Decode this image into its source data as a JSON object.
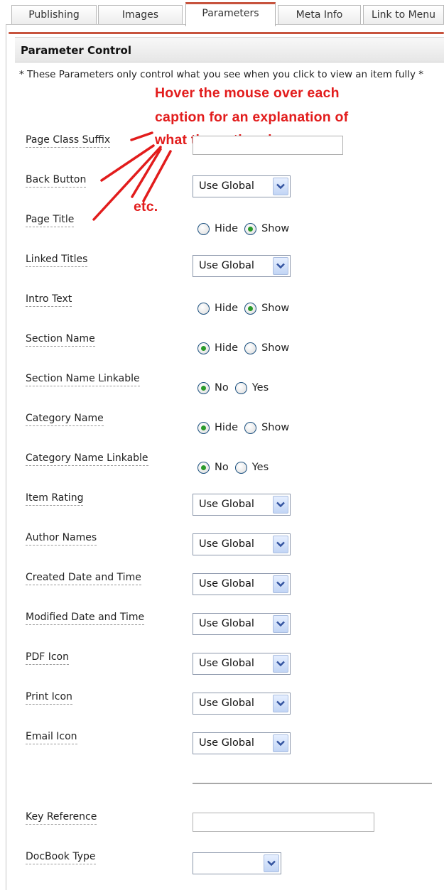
{
  "tabs": [
    {
      "label": "Publishing",
      "active": false
    },
    {
      "label": "Images",
      "active": false
    },
    {
      "label": "Parameters",
      "active": true
    },
    {
      "label": "Meta Info",
      "active": false
    },
    {
      "label": "Link to Menu",
      "active": false
    }
  ],
  "panel": {
    "title": "Parameter Control",
    "note": "* These Parameters only control what you see when you click to view an item fully *"
  },
  "annotation": {
    "lines": [
      "Hover the mouse over each",
      "caption for an explanation of",
      "what the option does"
    ],
    "etc": "etc.",
    "color": "#e21c1c"
  },
  "params": [
    {
      "label": "Page Class Suffix",
      "type": "text",
      "value": ""
    },
    {
      "label": "Back Button",
      "type": "select",
      "value": "Use Global"
    },
    {
      "label": "Page Title",
      "type": "radio",
      "options": [
        "Hide",
        "Show"
      ],
      "selected": "Show"
    },
    {
      "label": "Linked Titles",
      "type": "select",
      "value": "Use Global"
    },
    {
      "label": "Intro Text",
      "type": "radio",
      "options": [
        "Hide",
        "Show"
      ],
      "selected": "Show"
    },
    {
      "label": "Section Name",
      "type": "radio",
      "options": [
        "Hide",
        "Show"
      ],
      "selected": "Hide"
    },
    {
      "label": "Section Name Linkable",
      "type": "radio",
      "options": [
        "No",
        "Yes"
      ],
      "selected": "No"
    },
    {
      "label": "Category Name",
      "type": "radio",
      "options": [
        "Hide",
        "Show"
      ],
      "selected": "Hide"
    },
    {
      "label": "Category Name Linkable",
      "type": "radio",
      "options": [
        "No",
        "Yes"
      ],
      "selected": "No"
    },
    {
      "label": "Item Rating",
      "type": "select",
      "value": "Use Global"
    },
    {
      "label": "Author Names",
      "type": "select",
      "value": "Use Global"
    },
    {
      "label": "Created Date and Time",
      "type": "select",
      "value": "Use Global"
    },
    {
      "label": "Modified Date and Time",
      "type": "select",
      "value": "Use Global"
    },
    {
      "label": "PDF Icon",
      "type": "select",
      "value": "Use Global"
    },
    {
      "label": "Print Icon",
      "type": "select",
      "value": "Use Global"
    },
    {
      "label": "Email Icon",
      "type": "select",
      "value": "Use Global"
    },
    {
      "label": "Key Reference",
      "type": "text",
      "value": ""
    },
    {
      "label": "DocBook Type",
      "type": "select",
      "value": ""
    }
  ],
  "icons": {
    "dropdown": "chevron-down-icon",
    "radio": "radio-icon"
  },
  "colors": {
    "accent": "#c7533d",
    "annotation": "#e21c1c",
    "radio_dot": "#2a9a2a"
  }
}
